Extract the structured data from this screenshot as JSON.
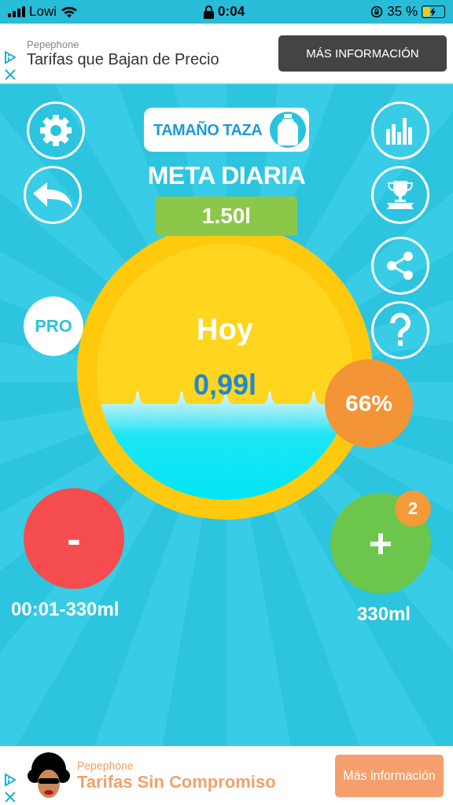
{
  "status_bar": {
    "carrier": "Lowi",
    "time": "0:04",
    "battery": "35 %"
  },
  "top_ad": {
    "advertiser": "Pepephone",
    "headline": "Tarifas que Bajan de Precio",
    "button": "MÁS INFORMACIÓN"
  },
  "cup_size_button": {
    "label": "TAMAÑO TAZA"
  },
  "daily_goal": {
    "title": "META DIARIA",
    "value": "1.50l"
  },
  "today": {
    "label": "Hoy",
    "amount": "0,99l",
    "percent": "66%"
  },
  "pro_button": {
    "label": "PRO"
  },
  "remove": {
    "label": "-",
    "last_entry": "00:01-330ml"
  },
  "add": {
    "label": "+",
    "badge": "2",
    "amount": "330ml"
  },
  "bottom_ad": {
    "advertiser": "Pepephone",
    "headline": "Tarifas Sin Compromiso",
    "button": "Más información"
  }
}
